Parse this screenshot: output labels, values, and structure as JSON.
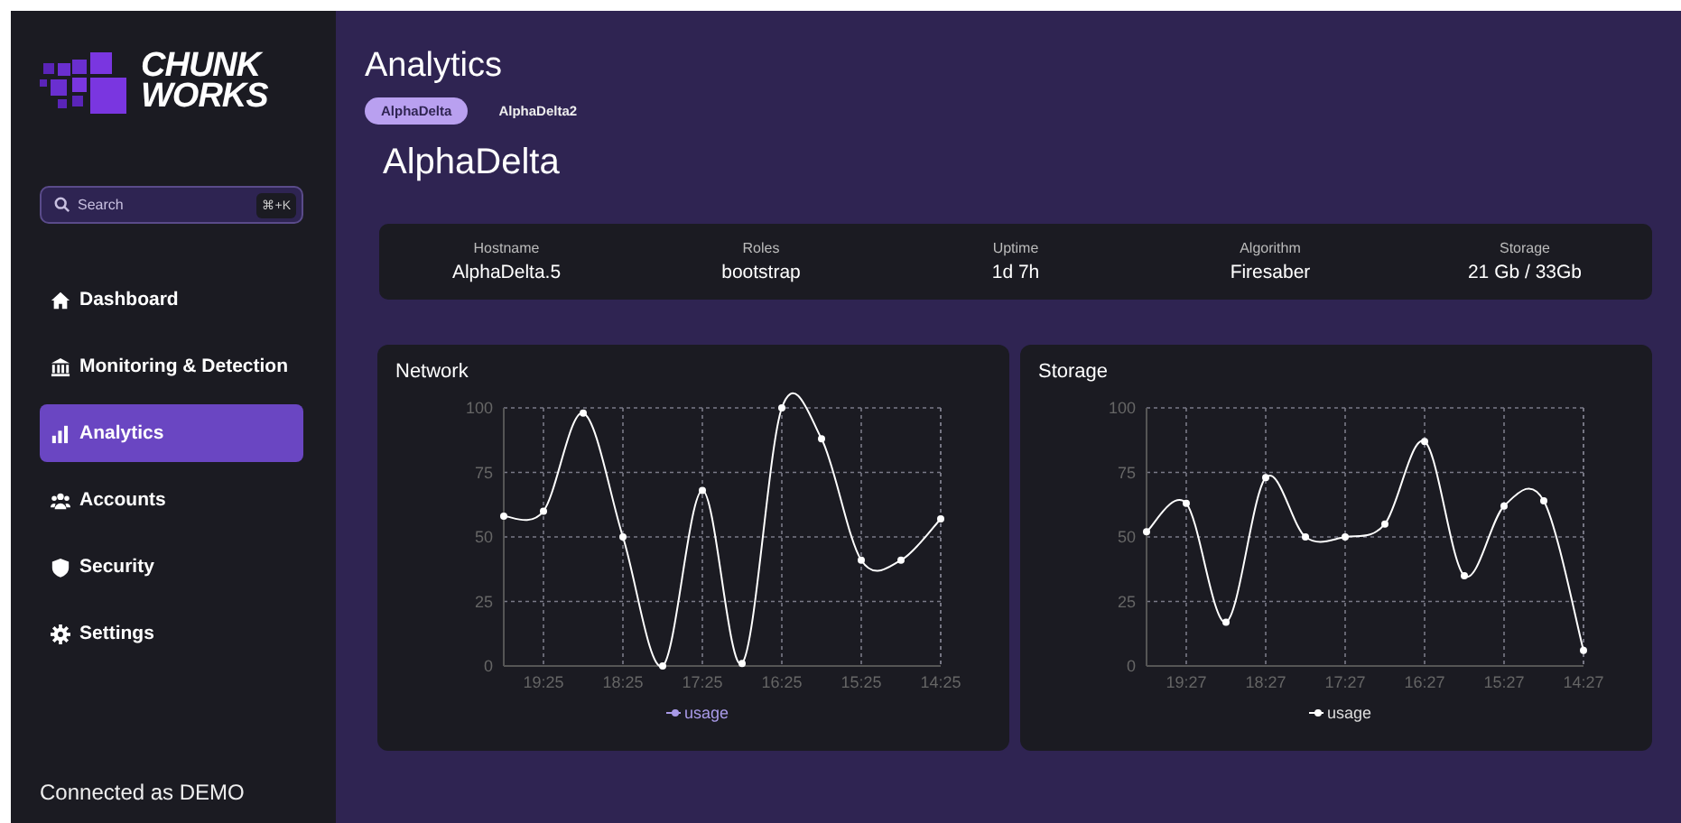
{
  "sidebar": {
    "logo": [
      "CHUNK",
      "WORKS"
    ],
    "search": {
      "placeholder": "Search",
      "shortcut": "⌘+K"
    },
    "items": [
      {
        "label": "Dashboard",
        "selected": false
      },
      {
        "label": "Monitoring & Detection",
        "selected": false
      },
      {
        "label": "Analytics",
        "selected": true
      },
      {
        "label": "Accounts",
        "selected": false
      },
      {
        "label": "Security",
        "selected": false
      },
      {
        "label": "Settings",
        "selected": false
      }
    ],
    "footer": "Connected as DEMO"
  },
  "page": {
    "title": "Analytics",
    "tabs": [
      {
        "label": "AlphaDelta",
        "selected": true
      },
      {
        "label": "AlphaDelta2",
        "selected": false
      }
    ],
    "heading": "AlphaDelta",
    "stats": [
      {
        "label": "Hostname",
        "value": "AlphaDelta.5"
      },
      {
        "label": "Roles",
        "value": "bootstrap"
      },
      {
        "label": "Uptime",
        "value": "1d 7h"
      },
      {
        "label": "Algorithm",
        "value": "Firesaber"
      },
      {
        "label": "Storage",
        "value": "21 Gb / 33Gb"
      }
    ],
    "charts": [
      {
        "title": "Network",
        "chart_data": {
          "type": "line",
          "categories": [
            null,
            "19:25",
            null,
            "18:25",
            null,
            "17:25",
            null,
            "16:25",
            null,
            "15:25",
            null,
            "14:25"
          ],
          "grid": true,
          "ylim": [
            0,
            100
          ],
          "yticks": [
            0,
            25,
            50,
            75,
            100
          ],
          "series": [
            {
              "name": "usage",
              "color": "#ffffff",
              "marker": true,
              "values": [
                58,
                60,
                98,
                50,
                0,
                68,
                1,
                100,
                88,
                41,
                41,
                57
              ]
            }
          ]
        }
      },
      {
        "title": "Storage",
        "chart_data": {
          "type": "line",
          "categories": [
            null,
            "19:27",
            null,
            "18:27",
            null,
            "17:27",
            null,
            "16:27",
            null,
            "15:27",
            null,
            "14:27"
          ],
          "grid": true,
          "ylim": [
            0,
            100
          ],
          "yticks": [
            0,
            25,
            50,
            75,
            100
          ],
          "series": [
            {
              "name": "usage",
              "color": "#ffffff",
              "marker": true,
              "values": [
                52,
                63,
                17,
                73,
                50,
                50,
                55,
                87,
                35,
                62,
                64,
                6
              ]
            }
          ]
        }
      }
    ]
  }
}
